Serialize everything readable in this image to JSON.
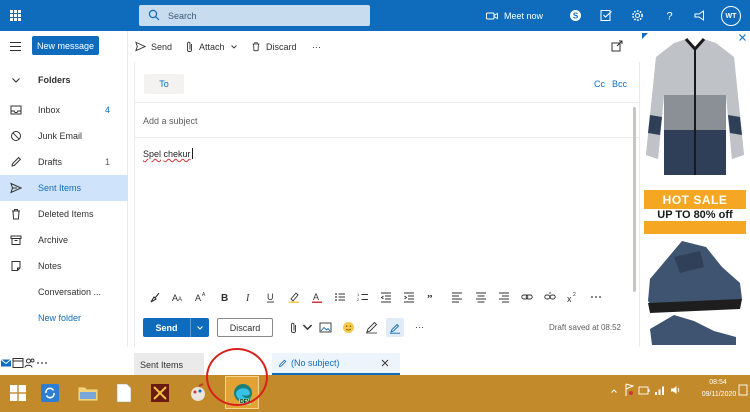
{
  "topbar": {
    "search_placeholder": "Search",
    "meet_now": "Meet now",
    "avatar_initials": "WT",
    "accent": "#0f6cbd"
  },
  "nav": {
    "new_message": "New message",
    "items": [
      {
        "label": "Folders",
        "count": "",
        "icon": "chevron-down-icon"
      },
      {
        "label": "Inbox",
        "count": "4",
        "icon": "inbox-icon"
      },
      {
        "label": "Junk Email",
        "count": "",
        "icon": "block-icon"
      },
      {
        "label": "Drafts",
        "count": "1",
        "icon": "pencil-icon"
      },
      {
        "label": "Sent Items",
        "count": "",
        "icon": "send-icon"
      },
      {
        "label": "Deleted Items",
        "count": "",
        "icon": "trash-icon"
      },
      {
        "label": "Archive",
        "count": "",
        "icon": "archive-icon"
      },
      {
        "label": "Notes",
        "count": "",
        "icon": "note-icon"
      },
      {
        "label": "Conversation ...",
        "count": "",
        "icon": ""
      },
      {
        "label": "New folder",
        "count": "",
        "icon": ""
      }
    ]
  },
  "compose_toolbar": {
    "send": "Send",
    "attach": "Attach",
    "discard": "Discard",
    "more": "···"
  },
  "compose": {
    "to_label": "To",
    "cc_label": "Cc",
    "bcc_label": "Bcc",
    "subject_placeholder": "Add a subject",
    "body_word1": "Spel",
    "body_word2": "chekur"
  },
  "actions": {
    "send": "Send",
    "discard": "Discard",
    "draft_saved": "Draft saved at 08:52",
    "more": "···"
  },
  "ad": {
    "hot_sale": "HOT SALE",
    "up_to": "UP TO 80% off"
  },
  "tabs": {
    "sent_items": "Sent Items",
    "no_subject": "(No subject)"
  },
  "taskbar": {
    "time": "08:54",
    "date": "09/11/2020",
    "color": "#c28a2b",
    "edge_badge": "DEV"
  }
}
